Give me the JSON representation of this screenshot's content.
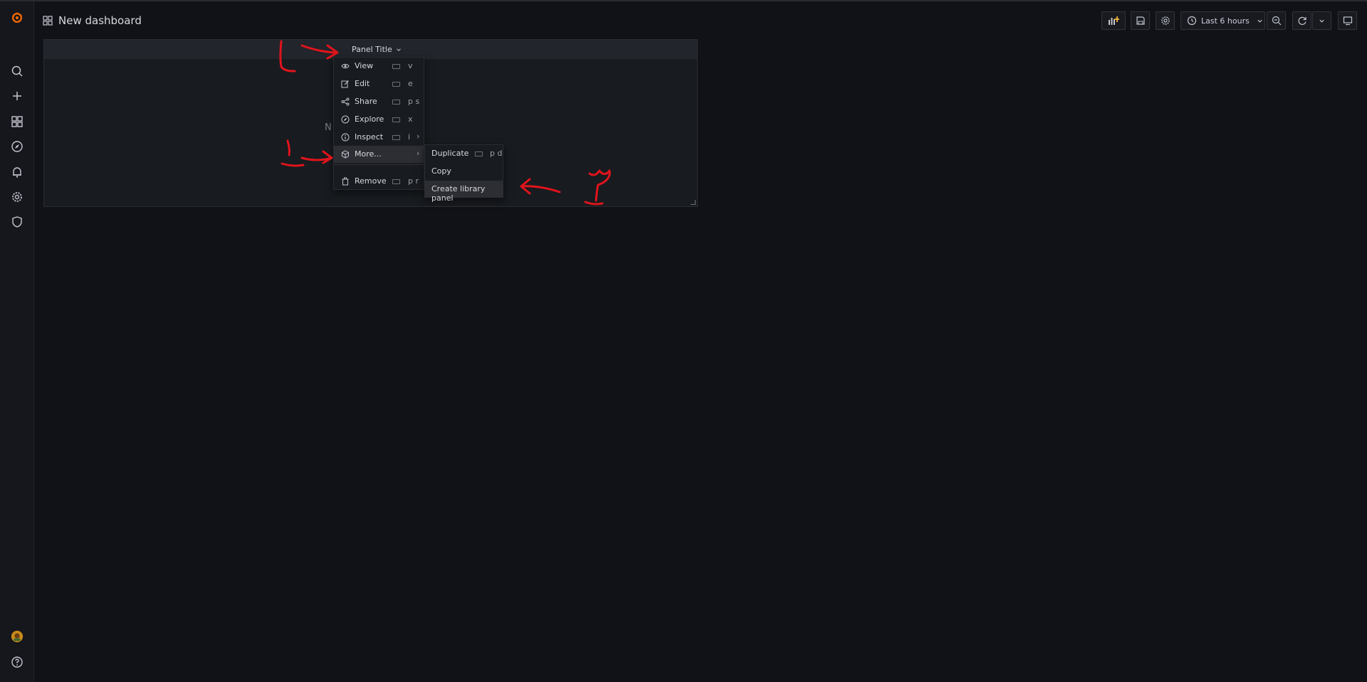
{
  "header": {
    "title": "New dashboard"
  },
  "toolbar": {
    "time_range": "Last 6 hours"
  },
  "sidebar": {
    "items": [
      {
        "name": "search"
      },
      {
        "name": "create"
      },
      {
        "name": "dashboards"
      },
      {
        "name": "explore"
      },
      {
        "name": "alerting"
      },
      {
        "name": "configuration"
      },
      {
        "name": "server-admin"
      }
    ]
  },
  "panel": {
    "title": "Panel Title",
    "no_data_partial": "N"
  },
  "menu": {
    "items": [
      {
        "label": "View",
        "shortcut": "v"
      },
      {
        "label": "Edit",
        "shortcut": "e"
      },
      {
        "label": "Share",
        "shortcut": "p s"
      },
      {
        "label": "Explore",
        "shortcut": "x"
      },
      {
        "label": "Inspect",
        "shortcut": "i"
      },
      {
        "label": "More...",
        "shortcut": ""
      },
      {
        "label": "Remove",
        "shortcut": "p r"
      }
    ],
    "submenu": [
      {
        "label": "Duplicate",
        "shortcut": "p d"
      },
      {
        "label": "Copy",
        "shortcut": ""
      },
      {
        "label": "Create library panel",
        "shortcut": ""
      }
    ]
  },
  "colors": {
    "background": "#111217",
    "panel": "#181b1f",
    "annotation": "#e0141c",
    "logo": "#f46800"
  }
}
